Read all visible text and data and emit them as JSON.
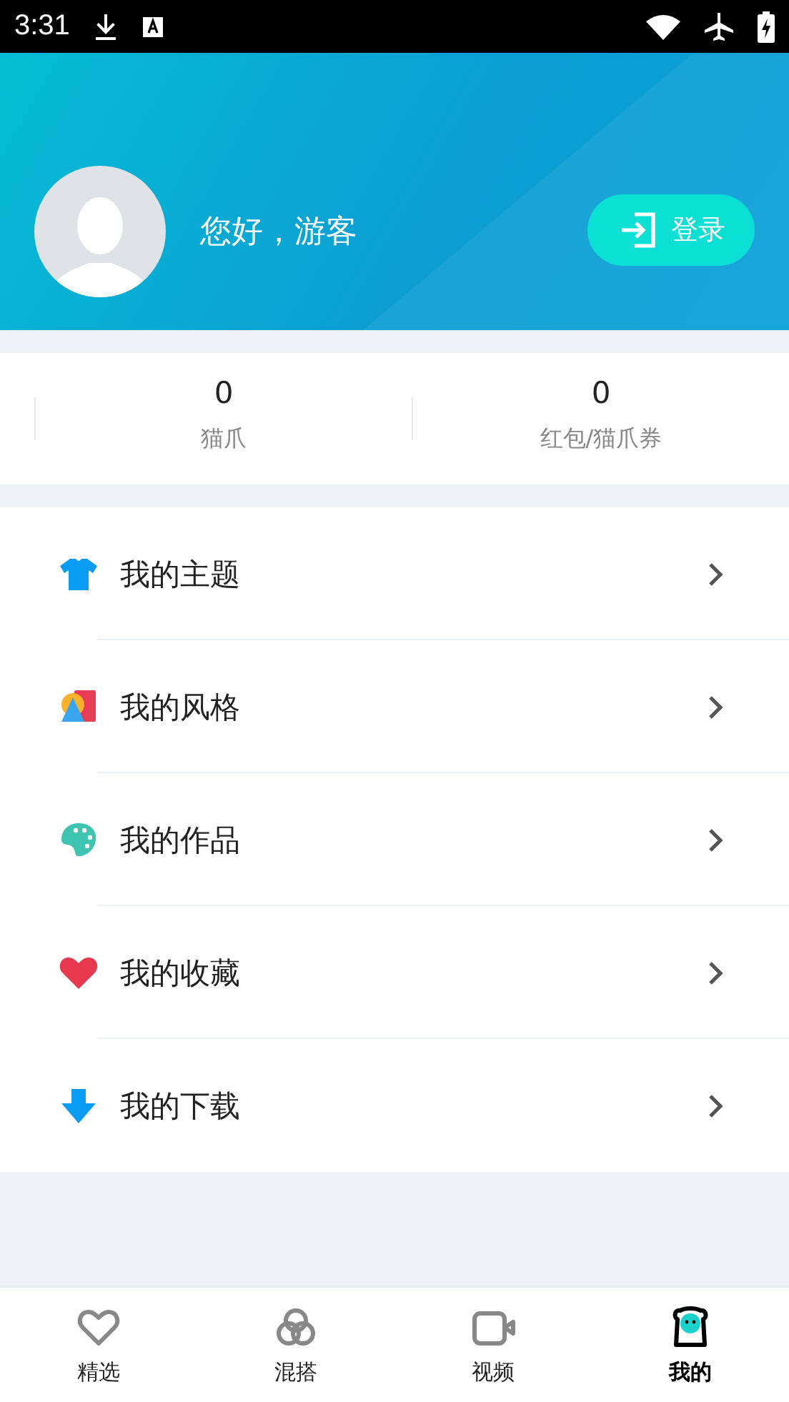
{
  "status_bar": {
    "time": "3:31"
  },
  "profile": {
    "greeting": "您好，游客",
    "login_button": "登录"
  },
  "stats": [
    {
      "value": "0",
      "label": "猫爪"
    },
    {
      "value": "0",
      "label": "红包/猫爪券"
    }
  ],
  "menu": [
    {
      "kind": "shirt",
      "label": "我的主题"
    },
    {
      "kind": "style",
      "label": "我的风格"
    },
    {
      "kind": "palette",
      "label": "我的作品"
    },
    {
      "kind": "heart",
      "label": "我的收藏"
    },
    {
      "kind": "download",
      "label": "我的下载"
    }
  ],
  "tabs": [
    {
      "kind": "heart",
      "label": "精选",
      "selected": false
    },
    {
      "kind": "rings",
      "label": "混搭",
      "selected": false
    },
    {
      "kind": "video",
      "label": "视频",
      "selected": false
    },
    {
      "kind": "mascot",
      "label": "我的",
      "selected": true
    }
  ]
}
